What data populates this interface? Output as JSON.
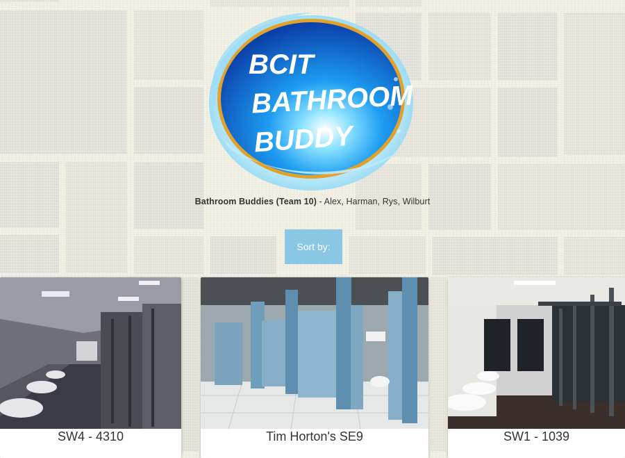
{
  "logo": {
    "lines": [
      "BCIT",
      "BATHROOM",
      "BUDDY"
    ],
    "colors": {
      "blue": "#0a52c2",
      "light_blue": "#1d9df2",
      "gold": "#e2a12a",
      "water": "#7fd3f4"
    }
  },
  "credits": {
    "team": "Bathroom Buddies (Team 10)",
    "members": " - Alex, Harman, Rys, Wilburt"
  },
  "sort": {
    "label": "Sort by:"
  },
  "cards": [
    {
      "label": "SW4 - 4310"
    },
    {
      "label": "Tim Horton's SE9"
    },
    {
      "label": "SW1 - 1039"
    }
  ]
}
